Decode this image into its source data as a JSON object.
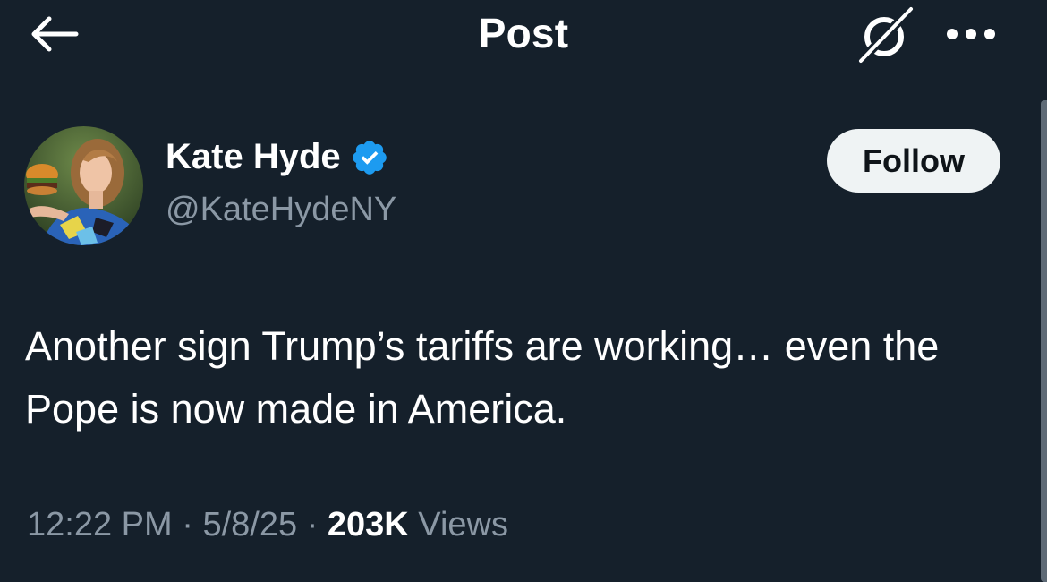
{
  "header": {
    "title": "Post",
    "back_icon": "arrow-left-icon",
    "grok_icon": "grok-icon",
    "more_icon": "more-horizontal-icon"
  },
  "author": {
    "display_name": "Kate Hyde",
    "handle": "@KateHydeNY",
    "verified_icon": "verified-badge-icon",
    "verified_color": "#1d9bf0"
  },
  "actions": {
    "follow_label": "Follow"
  },
  "post": {
    "text": "Another sign Trump’s tariffs are working… even the Pope is now made in America.",
    "time": "12:22 PM",
    "date": "5/8/25",
    "separator": " · ",
    "views_count": "203K",
    "views_label": "Views"
  },
  "colors": {
    "background": "#15202b",
    "secondary_text": "#8b98a5",
    "follow_bg": "#eff3f4",
    "follow_text": "#0f1419"
  }
}
